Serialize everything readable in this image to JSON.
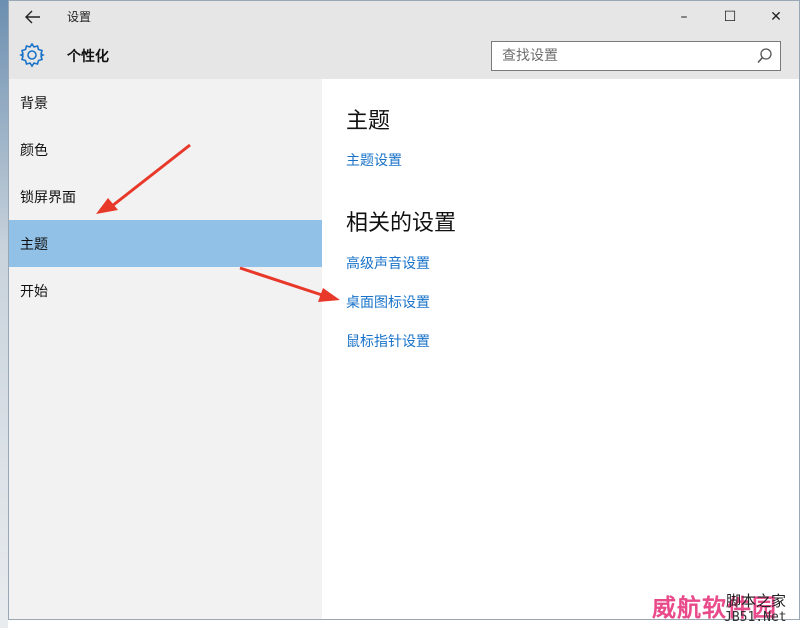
{
  "window": {
    "title": "设置",
    "back_icon": "arrow-left-icon",
    "controls": {
      "minimize": "–",
      "maximize": "☐",
      "close": "✕"
    }
  },
  "header": {
    "title": "个性化",
    "icon": "gear-icon",
    "search_placeholder": "查找设置"
  },
  "sidebar": {
    "items": [
      {
        "label": "背景",
        "active": false
      },
      {
        "label": "颜色",
        "active": false
      },
      {
        "label": "锁屏界面",
        "active": false
      },
      {
        "label": "主题",
        "active": true
      },
      {
        "label": "开始",
        "active": false
      }
    ]
  },
  "content": {
    "sections": [
      {
        "heading": "主题",
        "links": [
          "主题设置"
        ]
      },
      {
        "heading": "相关的设置",
        "links": [
          "高级声音设置",
          "桌面图标设置",
          "鼠标指针设置"
        ]
      }
    ]
  },
  "colors": {
    "accent": "#91c1e6",
    "link": "#1a73c9",
    "annotation_arrow": "#e8382a"
  },
  "watermark": {
    "brand": "威航软件园",
    "source": "脚本之家",
    "url": "JB51.Net"
  }
}
